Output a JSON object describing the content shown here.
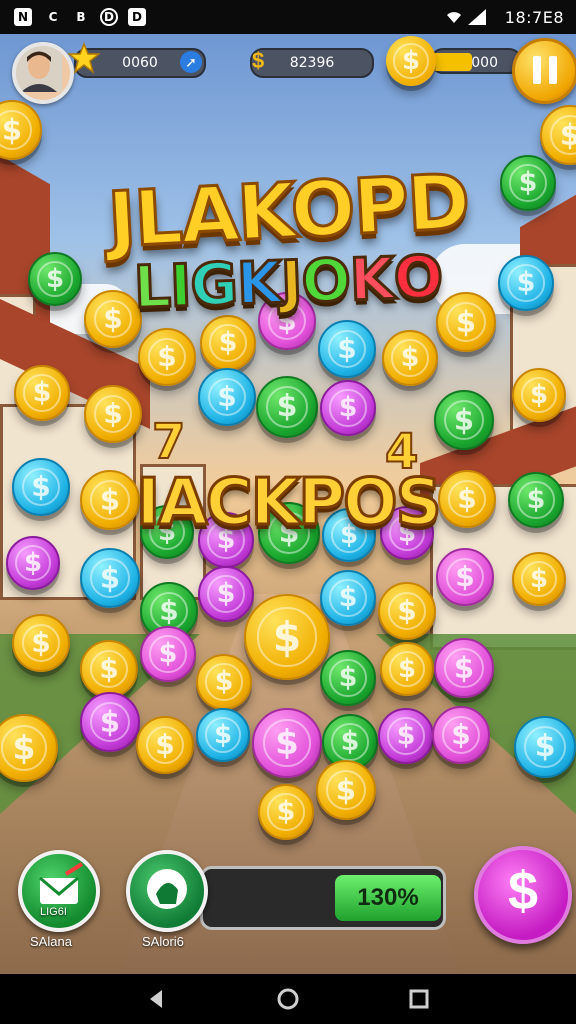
{
  "status_bar": {
    "left_icons": [
      "N",
      "C",
      "B",
      "D",
      "D"
    ],
    "time": "18:7E8"
  },
  "hud": {
    "level_value": "0060",
    "coin_value": "82396",
    "bonus_value": "000"
  },
  "title": {
    "main": "JLAKOPD",
    "sub_letters": [
      "L",
      "I",
      "G",
      "K",
      "J",
      "O",
      "K",
      "O"
    ],
    "sub_colors": [
      "#6ee04a",
      "#3ccf2f",
      "#2fd0b7",
      "#2b96e8",
      "#e8b621",
      "#4fd838",
      "#ff4f5e",
      "#ff2f3f"
    ],
    "jackpot": "IACKPOS",
    "num_left": "7",
    "num_right": "4"
  },
  "coin_symbol": "$",
  "colors": {
    "gold": "#f7c21a",
    "green": "#2ec43f",
    "cyan": "#28b8e8",
    "purple": "#c83ed8",
    "pink": "#e14fd9"
  },
  "bottom": {
    "left_button_label": "SAlana",
    "left_button_caption": "LIG6I",
    "mid_button_label": "SAlori6",
    "progress_text": "130%",
    "progress_fraction": 0.44
  },
  "icons": {
    "pause": "pause-icon",
    "star": "star-icon",
    "nav_back": "back-triangle-icon",
    "nav_home": "home-circle-icon",
    "nav_recent": "recent-square-icon"
  }
}
